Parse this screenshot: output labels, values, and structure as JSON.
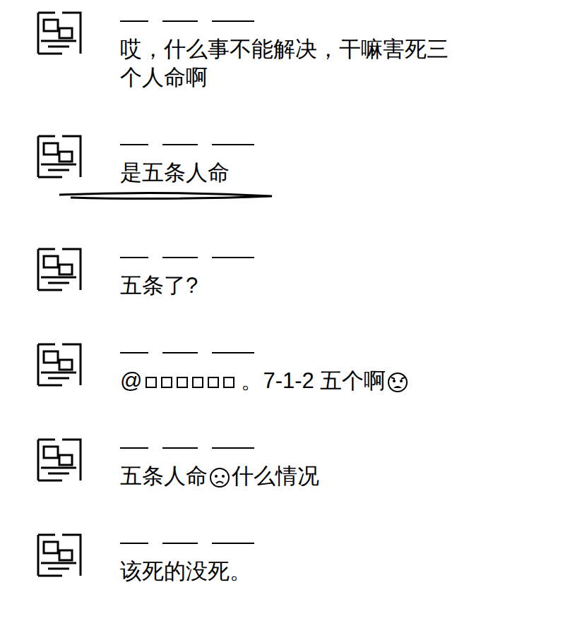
{
  "comments": [
    {
      "name_redacted": true,
      "underlined": false,
      "segments": [
        {
          "kind": "text",
          "text": "哎，什么事不能解决，干嘛害死三个人命啊"
        }
      ]
    },
    {
      "name_redacted": true,
      "underlined": true,
      "segments": [
        {
          "kind": "text",
          "text": "是五条人命"
        }
      ]
    },
    {
      "name_redacted": true,
      "underlined": false,
      "segments": [
        {
          "kind": "text",
          "text": "五条了?"
        }
      ]
    },
    {
      "name_redacted": true,
      "underlined": false,
      "segments": [
        {
          "kind": "text",
          "text": "@"
        },
        {
          "kind": "redacted"
        },
        {
          "kind": "text",
          "text": "。7-1-2  五个啊"
        },
        {
          "kind": "angry-emoji"
        }
      ]
    },
    {
      "name_redacted": true,
      "underlined": false,
      "segments": [
        {
          "kind": "text",
          "text": "五条人命"
        },
        {
          "kind": "sad-emoji"
        },
        {
          "kind": "text",
          "text": "什么情况"
        }
      ]
    },
    {
      "name_redacted": true,
      "underlined": false,
      "segments": [
        {
          "kind": "text",
          "text": "该死的没死。"
        }
      ]
    }
  ]
}
